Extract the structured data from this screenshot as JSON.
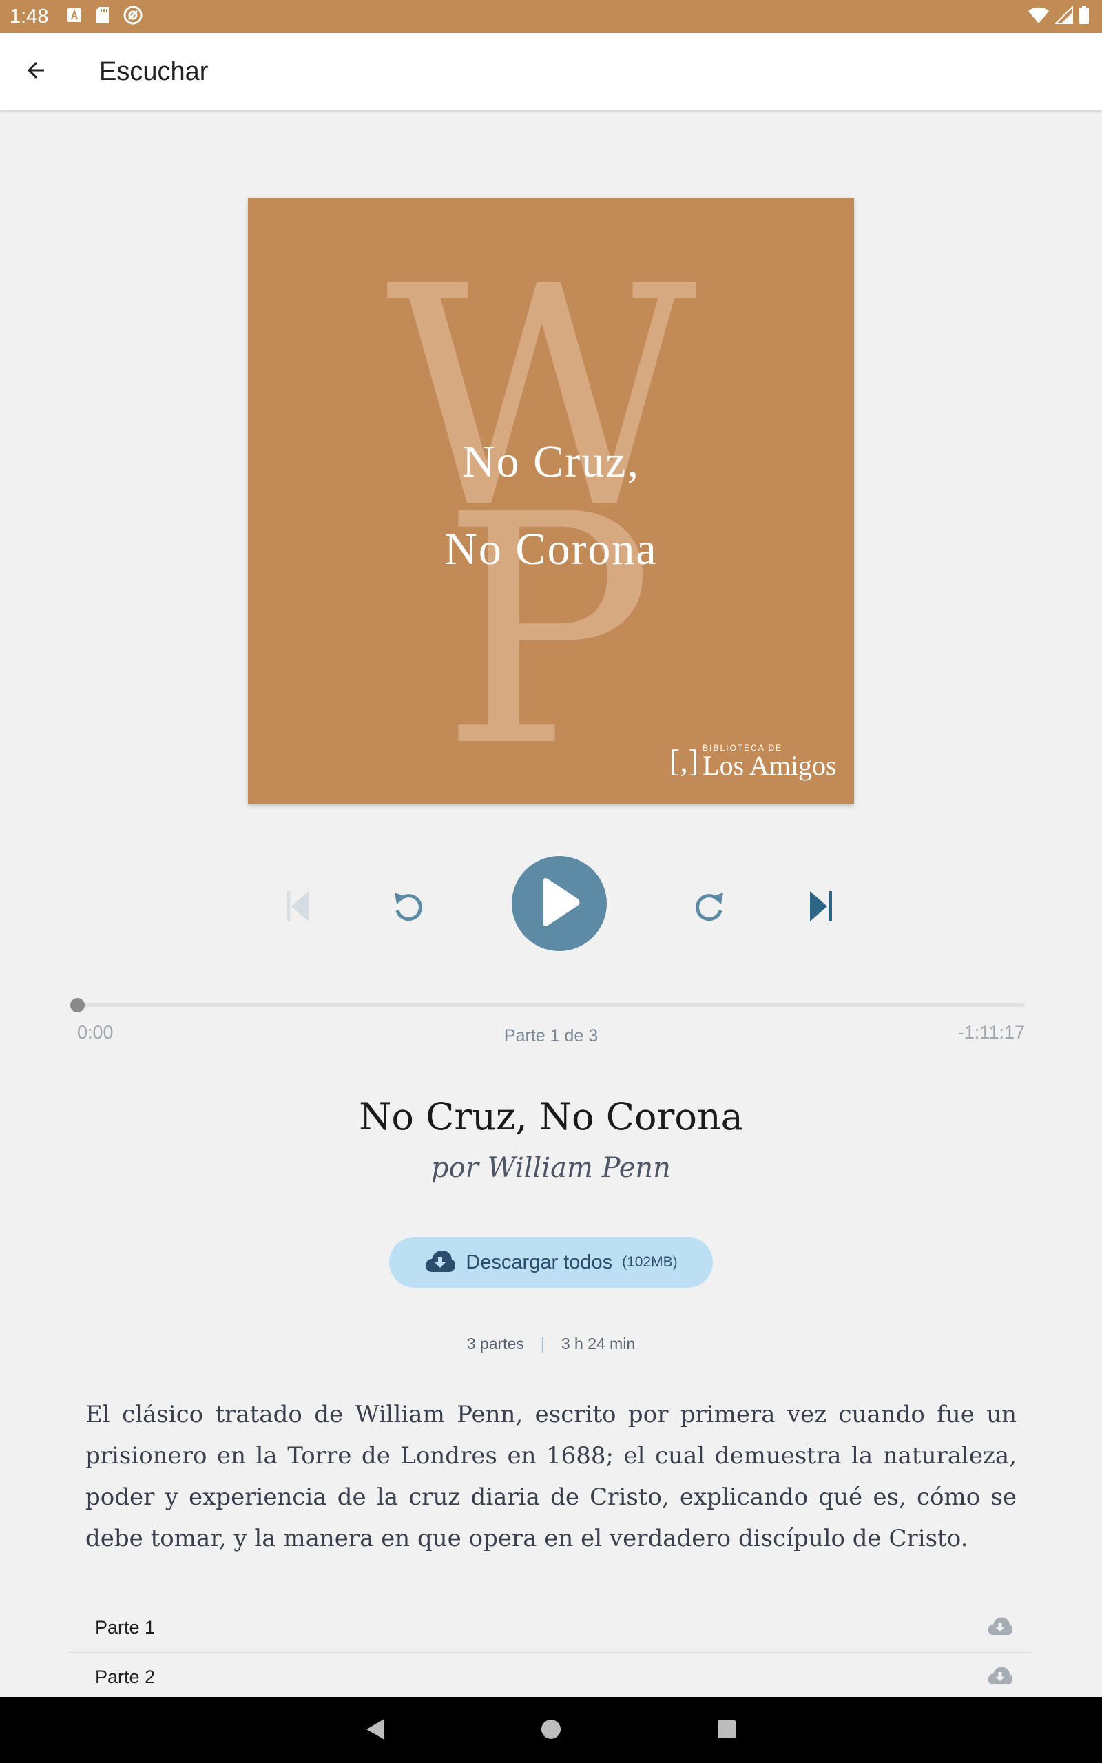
{
  "status_bar": {
    "time": "1:48",
    "left_icons": [
      "font-a-icon",
      "sd-card-icon",
      "sync-circle-icon"
    ],
    "right_icons": [
      "wifi-icon",
      "signal-icon",
      "battery-icon"
    ],
    "background": "#c18b56"
  },
  "app_bar": {
    "back_icon": "arrow-left-icon",
    "title": "Escuchar"
  },
  "cover": {
    "monogram_top": "W",
    "monogram_bottom": "P",
    "title_line1": "No Cruz,",
    "title_line2": "No Corona",
    "publisher_mark": "[,]",
    "publisher_small": "BIBLIOTECA DE",
    "publisher_name": "Los Amigos",
    "background": "#c18a57"
  },
  "player": {
    "controls": [
      {
        "icon": "skip-previous-icon",
        "enabled": false
      },
      {
        "icon": "rewind-icon",
        "enabled": true
      },
      {
        "icon": "play-icon",
        "enabled": true
      },
      {
        "icon": "fast-forward-icon",
        "enabled": true
      },
      {
        "icon": "skip-next-icon",
        "enabled": true
      }
    ],
    "accent": "#5d8ba6",
    "progress_fraction": 0,
    "elapsed": "0:00",
    "remaining": "-1:11:17",
    "part_indicator": "Parte 1 de 3"
  },
  "book": {
    "title": "No Cruz, No Corona",
    "author": "por William Penn"
  },
  "download_all": {
    "icon": "cloud-download-icon",
    "label": "Descargar todos",
    "size": "(102MB)",
    "background": "#bcdff4"
  },
  "meta": {
    "parts": "3 partes",
    "separator": "|",
    "duration": "3 h 24 min"
  },
  "description": "El clásico tratado de William Penn, escrito por primera vez cuando fue un prisionero en la Torre de Londres en 1688; el cual demuestra la naturaleza, poder y experiencia de la cruz diaria de Cristo, explicando qué es, cómo se debe tomar, y la manera en que opera en el verdadero discípulo de Cristo.",
  "parts_list": [
    {
      "label": "Parte 1",
      "icon": "cloud-download-icon"
    },
    {
      "label": "Parte 2",
      "icon": "cloud-download-icon"
    }
  ],
  "nav_bar": {
    "buttons": [
      "back-triangle-icon",
      "home-circle-icon",
      "recents-square-icon"
    ]
  }
}
